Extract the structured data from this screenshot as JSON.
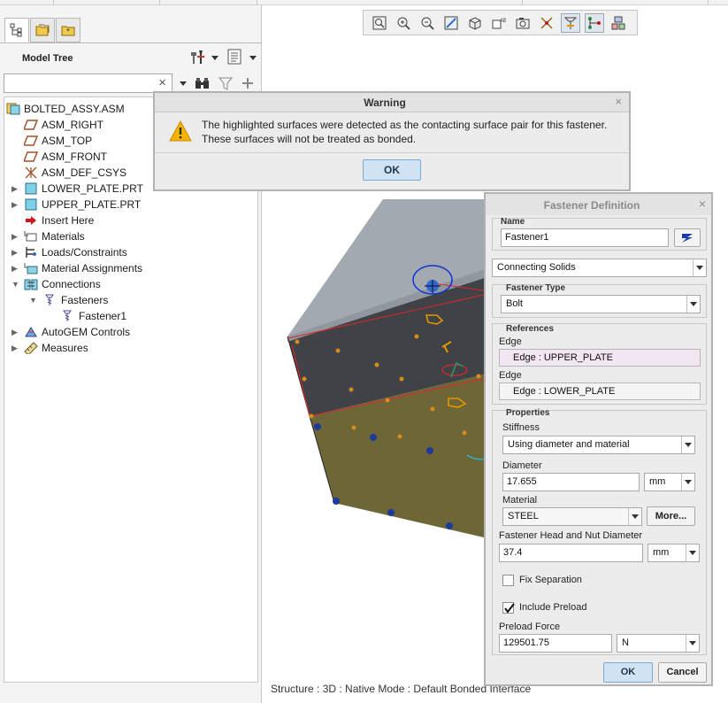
{
  "colors": {
    "accent": "#cfe3f3",
    "highlight": "#f3e6f3",
    "warning": "#f5b400",
    "bolt": "#e69500",
    "marker_blue": "#1e3a9a",
    "edge_red": "#e2262b"
  },
  "model_tree": {
    "title": "Model Tree",
    "search": {
      "value": "",
      "clear_icon": "×"
    },
    "items": [
      {
        "label": "BOLTED_ASSY.ASM",
        "icon": "assembly-icon"
      },
      {
        "label": "ASM_RIGHT",
        "icon": "datum-plane-icon"
      },
      {
        "label": "ASM_TOP",
        "icon": "datum-plane-icon"
      },
      {
        "label": "ASM_FRONT",
        "icon": "datum-plane-icon"
      },
      {
        "label": "ASM_DEF_CSYS",
        "icon": "csys-icon"
      },
      {
        "label": "LOWER_PLATE.PRT",
        "icon": "part-icon"
      },
      {
        "label": "UPPER_PLATE.PRT",
        "icon": "part-icon"
      },
      {
        "label": "Insert Here",
        "icon": "insert-arrow-icon"
      },
      {
        "label": "Materials",
        "icon": "materials-icon"
      },
      {
        "label": "Loads/Constraints",
        "icon": "loads-icon"
      },
      {
        "label": "Material Assignments",
        "icon": "material-assign-icon"
      },
      {
        "label": "Connections",
        "icon": "connections-icon"
      },
      {
        "label": "Fasteners",
        "icon": "fastener-folder-icon"
      },
      {
        "label": "Fastener1",
        "icon": "fastener-icon"
      },
      {
        "label": "AutoGEM Controls",
        "icon": "autogem-icon"
      },
      {
        "label": "Measures",
        "icon": "measure-icon"
      }
    ]
  },
  "warning": {
    "title": "Warning",
    "close": "×",
    "line1": "The highlighted surfaces were detected as the contacting surface pair for this fastener.",
    "line2": "These surfaces will not be treated as bonded.",
    "ok": "OK"
  },
  "fastener": {
    "title": "Fastener Definition",
    "close": "×",
    "name_label": "Name",
    "name_value": "Fastener1",
    "connecting": "Connecting Solids",
    "type_label": "Fastener Type",
    "type_value": "Bolt",
    "references_label": "References",
    "edge_label_1": "Edge",
    "edge_value_1": "Edge : UPPER_PLATE",
    "edge_label_2": "Edge",
    "edge_value_2": "Edge : LOWER_PLATE",
    "properties_label": "Properties",
    "stiffness_label": "Stiffness",
    "stiffness_value": "Using diameter and material",
    "diameter_label": "Diameter",
    "diameter_value": "17.655",
    "diameter_unit": "mm",
    "material_label": "Material",
    "material_value": "STEEL",
    "more_button": "More...",
    "head_label": "Fastener Head and Nut Diameter",
    "head_value": "37.4",
    "head_unit": "mm",
    "fix_separation": "Fix Separation",
    "fix_separation_checked": false,
    "include_preload": "Include Preload",
    "include_preload_checked": true,
    "preload_label": "Preload Force",
    "preload_value": "129501.75",
    "preload_unit": "N",
    "ok": "OK",
    "cancel": "Cancel"
  },
  "status": "Structure : 3D : Native Mode : Default Bonded Interface"
}
